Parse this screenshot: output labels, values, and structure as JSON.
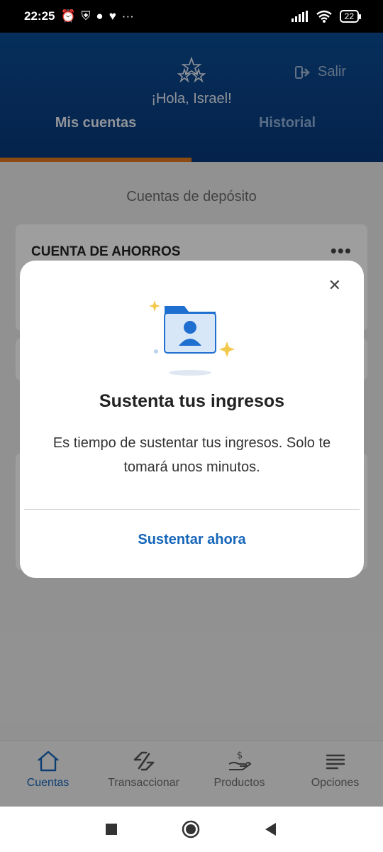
{
  "status_bar": {
    "time": "22:25",
    "battery": "22"
  },
  "header": {
    "greeting": "¡Hola, Israel!",
    "logout_label": "Salir",
    "tabs": [
      {
        "label": "Mis cuentas",
        "active": true
      },
      {
        "label": "Historial",
        "active": false
      }
    ]
  },
  "content": {
    "section_title": "Cuentas de depósito",
    "account_card_title": "CUENTA DE AHORROS"
  },
  "modal": {
    "title": "Sustenta tus ingresos",
    "body": "Es tiempo de sustentar tus ingresos. Solo te tomará unos minutos.",
    "action_label": "Sustentar ahora",
    "close_icon": "close-icon"
  },
  "bottom_nav": {
    "items": [
      {
        "label": "Cuentas",
        "icon": "home-icon",
        "active": true
      },
      {
        "label": "Transaccionar",
        "icon": "transfer-icon",
        "active": false
      },
      {
        "label": "Productos",
        "icon": "hand-money-icon",
        "active": false
      },
      {
        "label": "Opciones",
        "icon": "menu-lines-icon",
        "active": false
      }
    ]
  },
  "colors": {
    "primary": "#0b4c93",
    "accent": "#e07a20",
    "link": "#1565b8"
  }
}
